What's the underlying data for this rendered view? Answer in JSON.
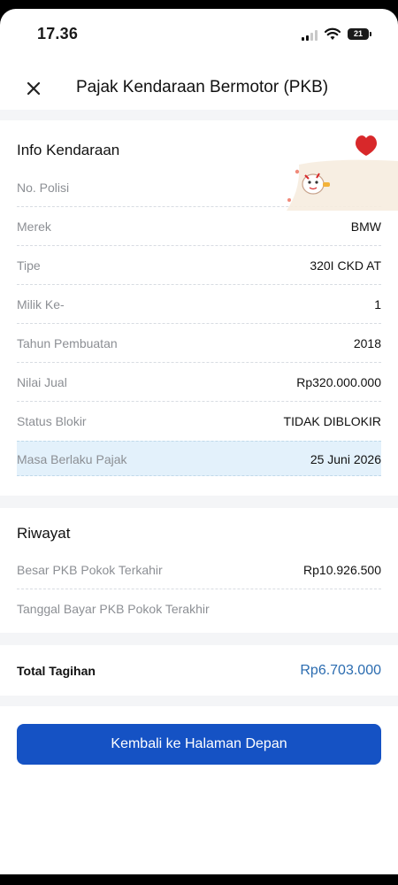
{
  "status_bar": {
    "time": "17.36",
    "battery": "21"
  },
  "header": {
    "title": "Pajak Kendaraan Bermotor (PKB)"
  },
  "info": {
    "title": "Info Kendaraan",
    "rows": [
      {
        "label": "No. Polisi",
        "value": ""
      },
      {
        "label": "Merek",
        "value": "BMW"
      },
      {
        "label": "Tipe",
        "value": "320I CKD AT"
      },
      {
        "label": "Milik Ke-",
        "value": "1"
      },
      {
        "label": "Tahun Pembuatan",
        "value": "2018"
      },
      {
        "label": "Nilai Jual",
        "value": "Rp320.000.000"
      },
      {
        "label": "Status Blokir",
        "value": "TIDAK DIBLOKIR"
      },
      {
        "label": "Masa Berlaku Pajak",
        "value": "25 Juni 2026"
      }
    ]
  },
  "history": {
    "title": "Riwayat",
    "rows": [
      {
        "label": "Besar PKB Pokok Terkahir",
        "value": "Rp10.926.500"
      },
      {
        "label": "Tanggal Bayar PKB Pokok Terakhir",
        "value": ""
      }
    ]
  },
  "total": {
    "label": "Total Tagihan",
    "value": "Rp6.703.000"
  },
  "actions": {
    "back_home": "Kembali ke Halaman Depan"
  },
  "colors": {
    "primary": "#1552c4",
    "total_value": "#2b6cb0",
    "highlight_row": "#e3f1fb",
    "heart": "#d8282a"
  }
}
